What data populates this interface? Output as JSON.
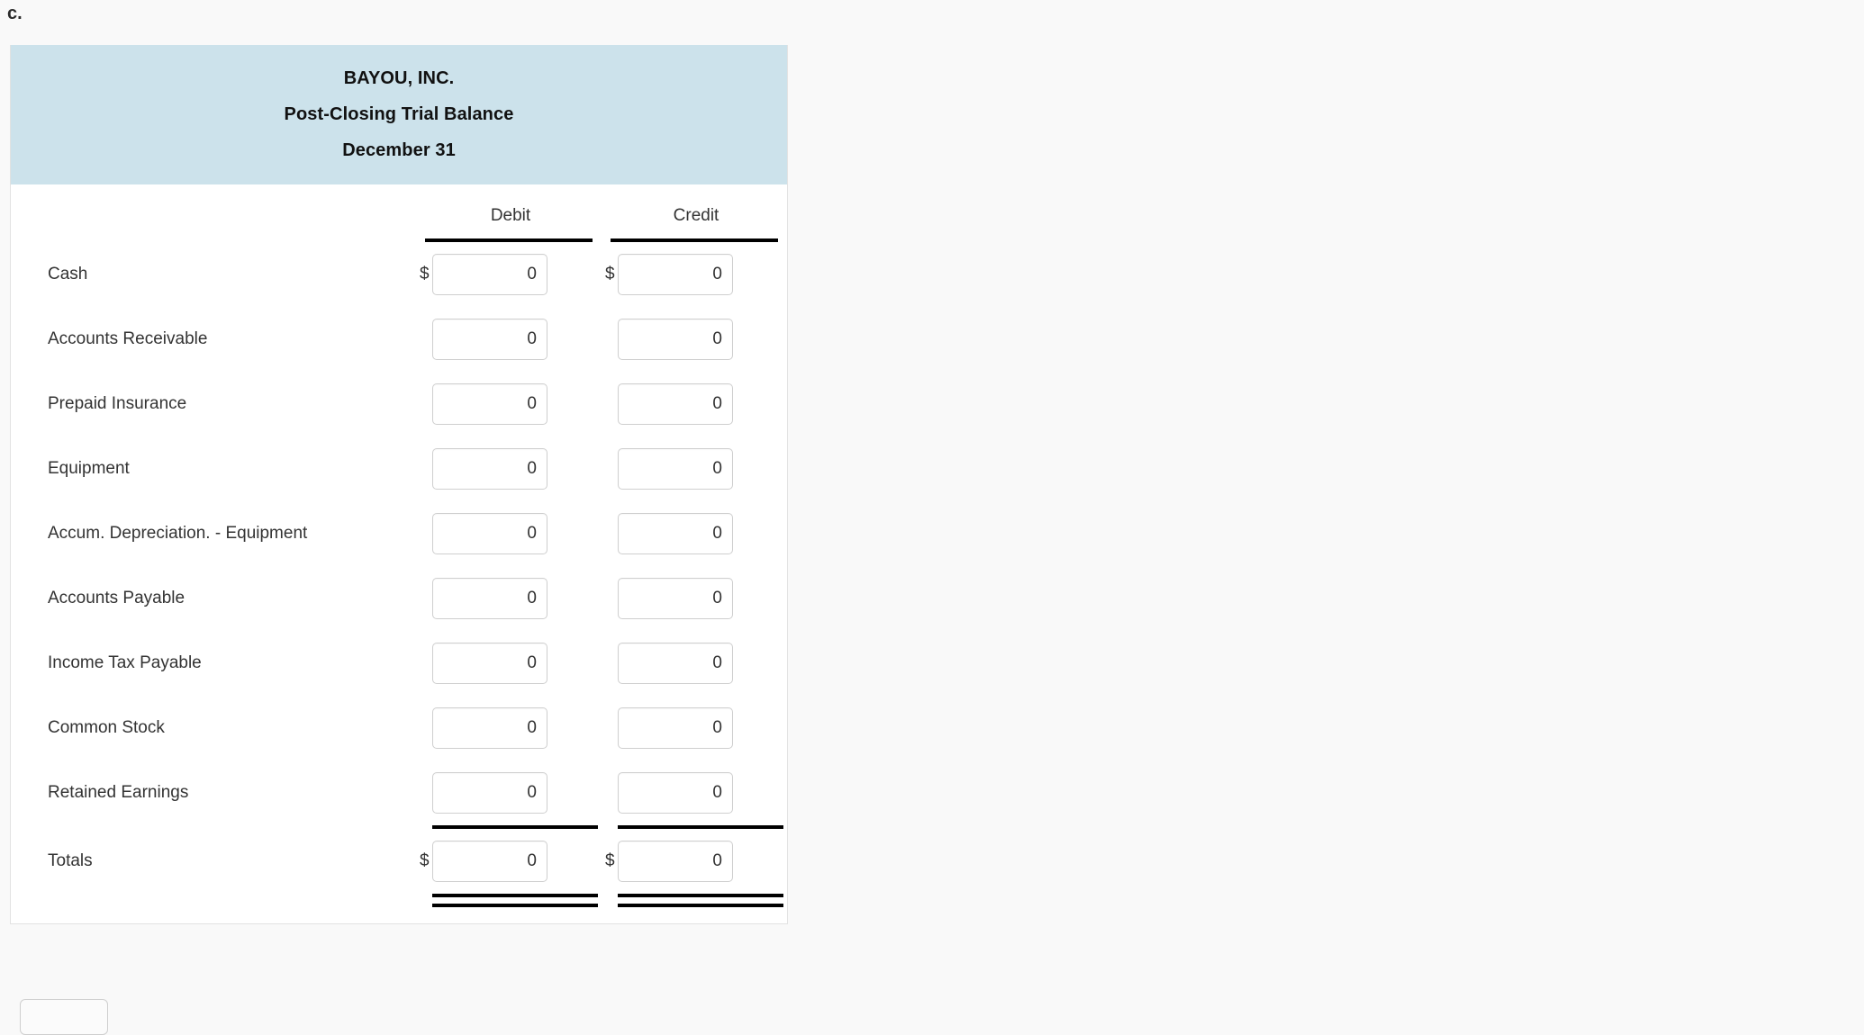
{
  "part_label": "c.",
  "colors": {
    "header_bg": "#cce2eb",
    "page_bg": "#f9f9f9",
    "panel_bg": "#ffffff",
    "rule": "#000000",
    "text": "#333333",
    "input_border": "#cfcfcf"
  },
  "statement": {
    "company": "BAYOU, INC.",
    "title": "Post-Closing Trial Balance",
    "date": "December 31",
    "columns": {
      "label": "",
      "debit": "Debit",
      "credit": "Credit"
    },
    "currency_symbol": "$",
    "rows": [
      {
        "label": "Cash",
        "debit": "0",
        "credit": "0",
        "show_currency": true
      },
      {
        "label": "Accounts Receivable",
        "debit": "0",
        "credit": "0",
        "show_currency": false
      },
      {
        "label": "Prepaid Insurance",
        "debit": "0",
        "credit": "0",
        "show_currency": false
      },
      {
        "label": "Equipment",
        "debit": "0",
        "credit": "0",
        "show_currency": false
      },
      {
        "label": "Accum. Depreciation. - Equipment",
        "debit": "0",
        "credit": "0",
        "show_currency": false
      },
      {
        "label": "Accounts Payable",
        "debit": "0",
        "credit": "0",
        "show_currency": false
      },
      {
        "label": "Income Tax Payable",
        "debit": "0",
        "credit": "0",
        "show_currency": false
      },
      {
        "label": "Common Stock",
        "debit": "0",
        "credit": "0",
        "show_currency": false
      },
      {
        "label": "Retained Earnings",
        "debit": "0",
        "credit": "0",
        "show_currency": false
      }
    ],
    "totals": {
      "label": "Totals",
      "debit": "0",
      "credit": "0",
      "show_currency": true
    }
  }
}
